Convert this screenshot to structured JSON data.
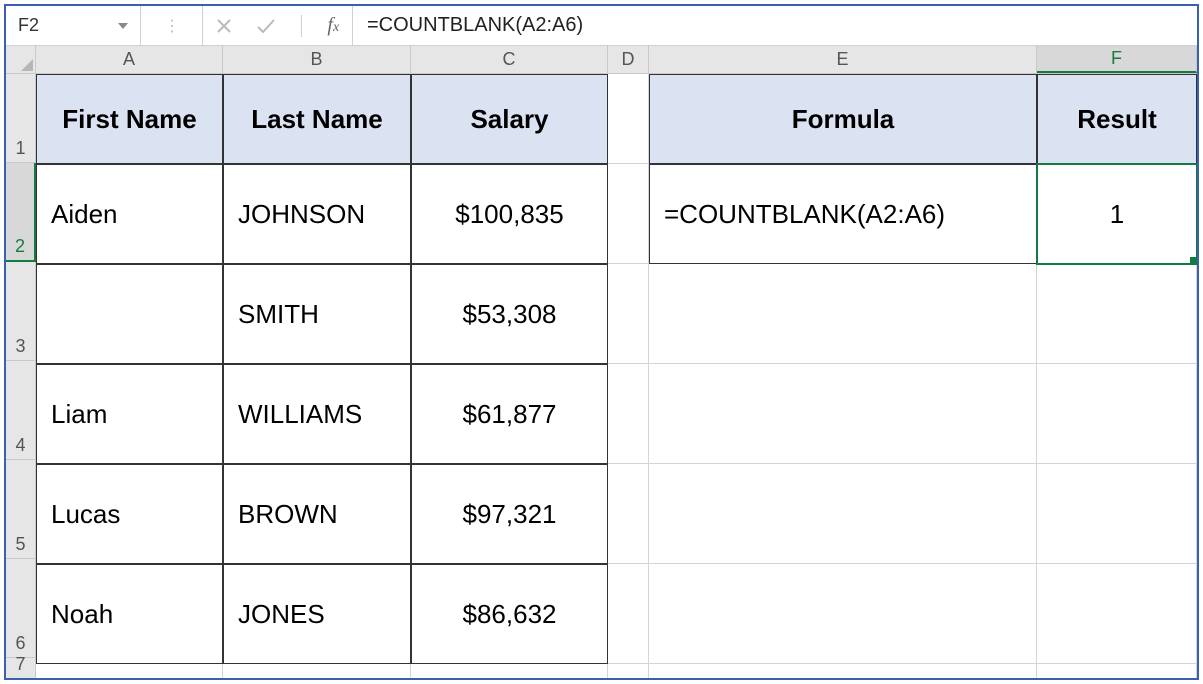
{
  "formula_bar": {
    "cell_ref": "F2",
    "formula": "=COUNTBLANK(A2:A6)"
  },
  "columns": [
    "A",
    "B",
    "C",
    "D",
    "E",
    "F"
  ],
  "row_numbers": [
    "1",
    "2",
    "3",
    "4",
    "5",
    "6",
    "7"
  ],
  "headers": {
    "A": "First Name",
    "B": "Last Name",
    "C": "Salary",
    "E": "Formula",
    "F": "Result"
  },
  "table_rows": [
    {
      "first": "Aiden",
      "last": "JOHNSON",
      "salary": "$100,835"
    },
    {
      "first": "",
      "last": "SMITH",
      "salary": "$53,308"
    },
    {
      "first": "Liam",
      "last": "WILLIAMS",
      "salary": "$61,877"
    },
    {
      "first": "Lucas",
      "last": "BROWN",
      "salary": "$97,321"
    },
    {
      "first": "Noah",
      "last": "JONES",
      "salary": "$86,632"
    }
  ],
  "formula_cell": "=COUNTBLANK(A2:A6)",
  "result_cell": "1"
}
